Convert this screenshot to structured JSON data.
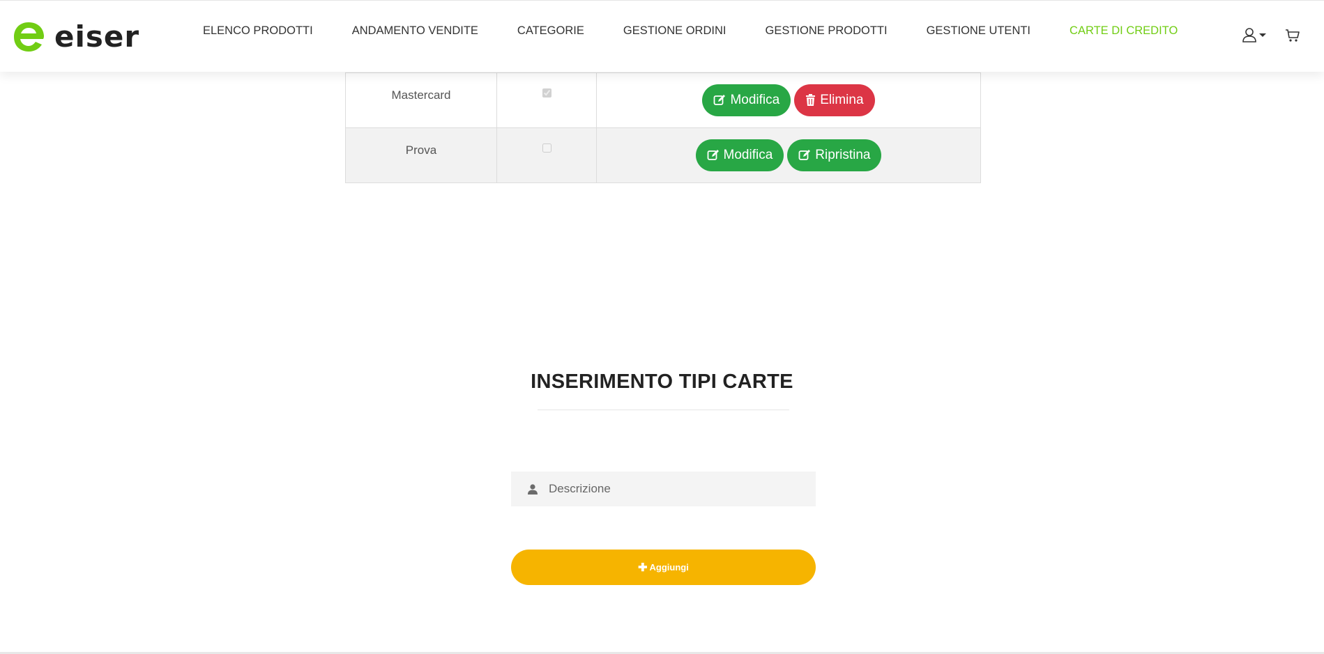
{
  "brand": {
    "logo_text": "eiser",
    "accent_color": "#71cd14"
  },
  "nav": {
    "items": [
      {
        "label": "ELENCO PRODOTTI"
      },
      {
        "label": "ANDAMENTO VENDITE"
      },
      {
        "label": "CATEGORIE"
      },
      {
        "label": "GESTIONE ORDINI"
      },
      {
        "label": "GESTIONE PRODOTTI"
      },
      {
        "label": "GESTIONE UTENTI"
      },
      {
        "label": "CARTE DI CREDITO",
        "active": true
      }
    ]
  },
  "table": {
    "rows": [
      {
        "name": "Mastercard",
        "checked": true,
        "buttons": [
          {
            "label": "Modifica",
            "icon": "edit-icon",
            "color": "#28a745"
          },
          {
            "label": "Elimina",
            "icon": "trash-icon",
            "color": "#dc3545"
          }
        ]
      },
      {
        "name": "Prova",
        "checked": false,
        "buttons": [
          {
            "label": "Modifica",
            "icon": "edit-icon",
            "color": "#28a745"
          },
          {
            "label": "Ripristina",
            "icon": "edit-icon",
            "color": "#28a745"
          }
        ]
      }
    ]
  },
  "form": {
    "title": "INSERIMENTO TIPI CARTE",
    "description_placeholder": "Descrizione",
    "description_value": "",
    "add_label": "Aggiungi",
    "add_color": "#f6b400"
  }
}
